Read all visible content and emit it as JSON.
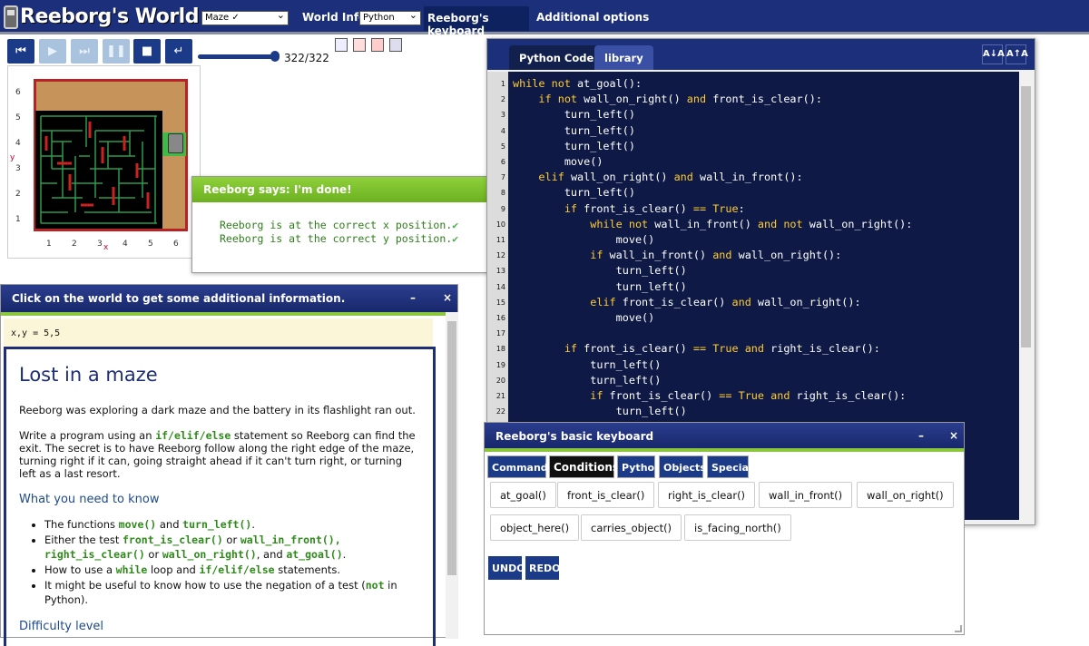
{
  "app": {
    "title": "Reeborg's World",
    "world_select": "Maze ✓",
    "world_info": "World Info",
    "language_select": "Python",
    "keyboard_link": "Reeborg's keyboard",
    "options_link": "Additional options"
  },
  "controls": {
    "buttons": [
      "reload-icon",
      "run-icon",
      "step-icon",
      "pause-icon",
      "stop-icon",
      "return-icon"
    ],
    "step_value": "322/322",
    "step_progress": 1.0
  },
  "world": {
    "y_axis_label": "y",
    "x_axis_label": "x",
    "y_ticks": [
      "6",
      "5",
      "4",
      "3",
      "2",
      "1"
    ],
    "x_ticks": [
      "1",
      "2",
      "3",
      "4",
      "5",
      "6"
    ]
  },
  "dialog": {
    "title": "Reeborg says: I'm done!",
    "close": "×",
    "lines": [
      "Reeborg is at the correct x position.",
      "Reeborg is at the correct y position."
    ],
    "check": "✔"
  },
  "info": {
    "header": "Click on the world to get some additional information.",
    "minimize": "–",
    "close": "×",
    "coords": "x,y = 5,5",
    "title": "Lost in a maze",
    "intro": "Reeborg was exploring a dark maze and the battery in its flashlight ran out.",
    "p2_a": "Write a program using an ",
    "p2_code": "if/elif/else",
    "p2_b": " statement so Reeborg can find the exit. The secret is to have Reeborg follow along the right edge of the maze, turning right if it can, going straight ahead if it can't turn right, or turning left as a last resort.",
    "need_heading": "What you need to know",
    "b1_a": "The functions ",
    "b1_c1": "move()",
    "b1_b": " and ",
    "b1_c2": "turn_left()",
    "b1_d": ".",
    "b2_a": "Either the test ",
    "b2_c1": "front_is_clear()",
    "b2_b": " or ",
    "b2_c2": "wall_in_front(),",
    "b2_c3": "right_is_clear()",
    "b2_d": " or ",
    "b2_c4": "wall_on_right()",
    "b2_e": ", and ",
    "b2_c5": "at_goal()",
    "b2_f": ".",
    "b3_a": "How to use a ",
    "b3_c1": "while",
    "b3_b": " loop and ",
    "b3_c2": "if/elif/else",
    "b3_d": " statements.",
    "b4_a": "It might be useful to know how to use the negation of a test (",
    "b4_c": "not",
    "b4_b": " in Python).",
    "difficulty_heading": "Difficulty level"
  },
  "editor": {
    "tab_code": "Python Code",
    "tab_library": "library",
    "font_down": "A↓A",
    "font_up": "A↑A",
    "line_numbers": [
      "1",
      "2",
      "3",
      "4",
      "5",
      "6",
      "7",
      "8",
      "9",
      "10",
      "11",
      "12",
      "13",
      "14",
      "15",
      "16",
      "17",
      "18",
      "19",
      "20",
      "21",
      "22"
    ],
    "lines": [
      [
        [
          "kw",
          "while not "
        ],
        [
          "t",
          "at_goal():"
        ]
      ],
      [
        [
          "t",
          "    "
        ],
        [
          "kw",
          "if not "
        ],
        [
          "t",
          "wall_on_right() "
        ],
        [
          "kw",
          "and "
        ],
        [
          "t",
          "front_is_clear():"
        ]
      ],
      [
        [
          "t",
          "        turn_left()"
        ]
      ],
      [
        [
          "t",
          "        turn_left()"
        ]
      ],
      [
        [
          "t",
          "        turn_left()"
        ]
      ],
      [
        [
          "t",
          "        move()"
        ]
      ],
      [
        [
          "t",
          "    "
        ],
        [
          "kw",
          "elif "
        ],
        [
          "t",
          "wall_on_right() "
        ],
        [
          "kw",
          "and "
        ],
        [
          "t",
          "wall_in_front():"
        ]
      ],
      [
        [
          "t",
          "        turn_left()"
        ]
      ],
      [
        [
          "t",
          "        "
        ],
        [
          "kw",
          "if "
        ],
        [
          "t",
          "front_is_clear() "
        ],
        [
          "kw",
          "== True"
        ],
        [
          "t",
          ":"
        ]
      ],
      [
        [
          "t",
          "            "
        ],
        [
          "kw",
          "while not "
        ],
        [
          "t",
          "wall_in_front() "
        ],
        [
          "kw",
          "and not "
        ],
        [
          "t",
          "wall_on_right():"
        ]
      ],
      [
        [
          "t",
          "                move()"
        ]
      ],
      [
        [
          "t",
          "            "
        ],
        [
          "kw",
          "if "
        ],
        [
          "t",
          "wall_in_front() "
        ],
        [
          "kw",
          "and "
        ],
        [
          "t",
          "wall_on_right():"
        ]
      ],
      [
        [
          "t",
          "                turn_left()"
        ]
      ],
      [
        [
          "t",
          "                turn_left()"
        ]
      ],
      [
        [
          "t",
          "            "
        ],
        [
          "kw",
          "elif "
        ],
        [
          "t",
          "front_is_clear() "
        ],
        [
          "kw",
          "and "
        ],
        [
          "t",
          "wall_on_right():"
        ]
      ],
      [
        [
          "t",
          "                move()"
        ]
      ],
      [
        [
          "t",
          ""
        ]
      ],
      [
        [
          "t",
          "        "
        ],
        [
          "kw",
          "if "
        ],
        [
          "t",
          "front_is_clear() "
        ],
        [
          "kw",
          "== True and "
        ],
        [
          "t",
          "right_is_clear():"
        ]
      ],
      [
        [
          "t",
          "            turn_left()"
        ]
      ],
      [
        [
          "t",
          "            turn_left()"
        ]
      ],
      [
        [
          "t",
          "            "
        ],
        [
          "kw",
          "if "
        ],
        [
          "t",
          "front_is_clear() "
        ],
        [
          "kw",
          "== True and "
        ],
        [
          "t",
          "right_is_clear():"
        ]
      ],
      [
        [
          "t",
          "                turn_left()"
        ]
      ]
    ]
  },
  "keyboard": {
    "title": "Reeborg's basic keyboard",
    "minimize": "–",
    "close": "×",
    "tabs": [
      "Commands",
      "Conditions",
      "Python",
      "Objects",
      "Special"
    ],
    "active_tab": "Conditions",
    "buttons": [
      "at_goal()",
      "front_is_clear()",
      "right_is_clear()",
      "wall_in_front()",
      "wall_on_right()",
      "object_here()",
      "carries_object()",
      "is_facing_north()"
    ],
    "undo": "UNDO",
    "redo": "REDO"
  },
  "colors": {
    "header_blue": "#1b2f7a",
    "accent_green": "#8cc63f",
    "editor_bg": "#0e1a45",
    "keyword": "#ffcc33",
    "maze_wall": "#b92222",
    "maze_path": "#2e9b4a",
    "check_green": "#2e7d1a"
  }
}
